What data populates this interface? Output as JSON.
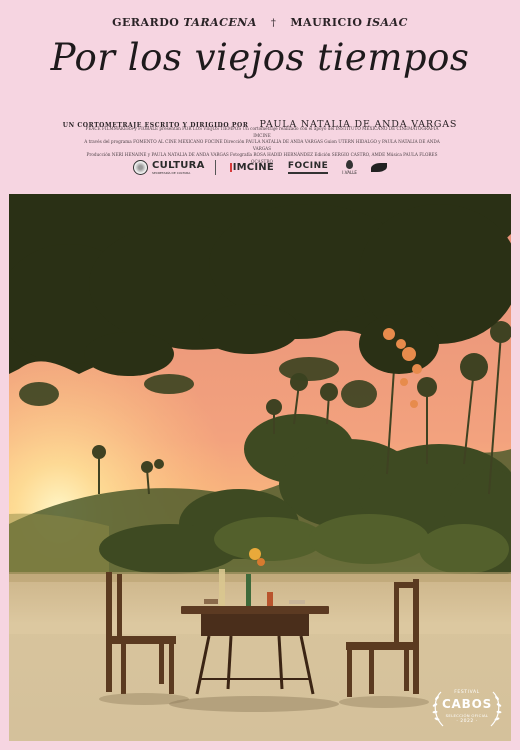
{
  "cast": [
    {
      "first": "GERARDO",
      "last": "TARACENA"
    },
    {
      "first": "MAURICIO",
      "last": "ISAAC"
    }
  ],
  "cast_separator": "†",
  "title": "Por los viejos tiempos",
  "credit": {
    "small": "UN CORTOMETRAJE ESCRITO Y DIRIGIDO POR",
    "name": "PAULA NATALIA DE ANDA VARGAS"
  },
  "fine_print": [
    "PEACE FILMMAKERS y FIOBALE presentan POR LOS VIEJOS TIEMPOS Un cortometraje realizado con el apoyo del INSTITUTO MEXICANO DE CINEMATOGRAFÍA IMCINE",
    "A través del programa FOMENTO AL CINE MEXICANO FOCINE Dirección PAULA NATALIA DE ANDA VARGAS Guion UTERN HIDALGO y PAULA NATALIA DE ANDA VARGAS",
    "Producción NERI HENAINE y PAULA NATALIA DE ANDA VARGAS Fotografía ROSA HADID HERNÁNDEZ Edición SERGIO CASTRO, AMDE Música PAULA FLORES OCASTRO"
  ],
  "logos": {
    "cultura": "CULTURA",
    "cultura_sub": "SECRETARÍA DE CULTURA",
    "imcine": "IMCINE",
    "focine": "FOCINE",
    "ivalle": "I.VALLE"
  },
  "badge": {
    "festival": "FESTIVAL",
    "name": "CABOS",
    "selection": "SELECCIÓN OFICIAL",
    "year": "· 2022 ·"
  },
  "colors": {
    "background": "#f6d5e1",
    "sky_top": "#e99b7f",
    "sky_horizon": "#ffd98a",
    "ground": "#d8c59d"
  }
}
